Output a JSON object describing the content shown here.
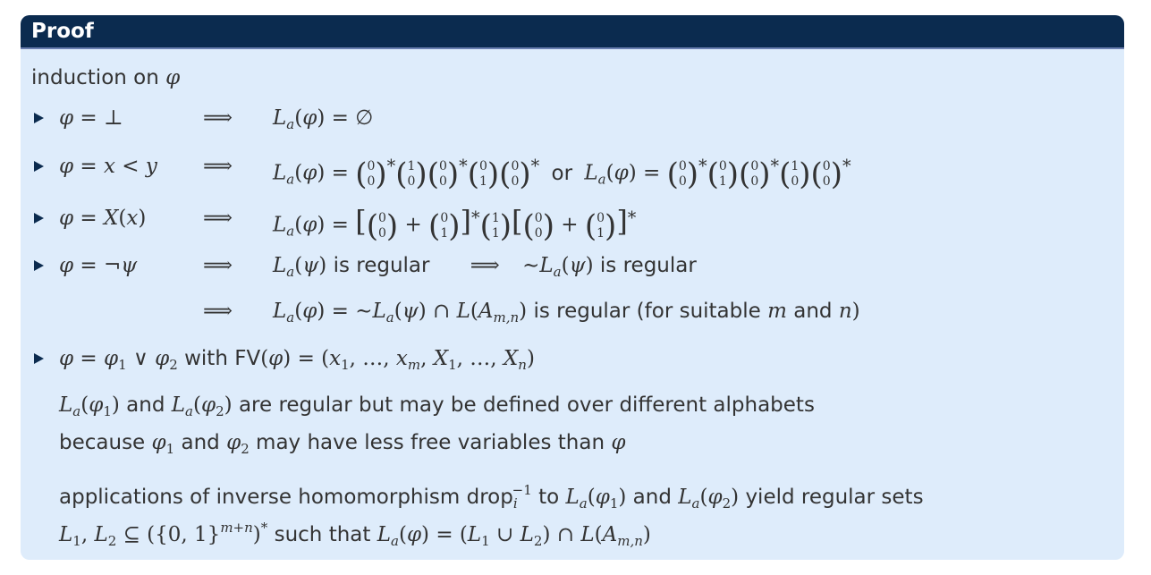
{
  "block": {
    "title": "Proof"
  },
  "lines": {
    "intro": "induction on",
    "intro_phi": "φ",
    "case1_lhs": "φ = ⊥",
    "implies": "⟹",
    "case1_rhs_L": "L",
    "sub_a": "a",
    "case1_rhs_rest": "(φ) = ∅",
    "case2_lhs": "φ = x < y",
    "case2_or": "or",
    "case3_lhs": "φ = X(x)",
    "case4_lhs": "φ = ¬ψ",
    "case4_mid": "(ψ)",
    "is_regular": "is regular",
    "tilde": "∼",
    "case4b_text": "is regular",
    "case4b_paren": "(for suitable",
    "m": "m",
    "and": "and",
    "n": "n",
    "close_paren": ")",
    "case5_lhs": "φ = φ",
    "case5_with": "with",
    "case5_fv": "FV(φ) = (x",
    "l6_a": "are regular but may be defined over different alphabets",
    "l7_a": "because",
    "l7_b": "may have less free variables than",
    "l8_a": "applications of inverse homomorphism",
    "l8_drop": "drop",
    "l8_to": "to",
    "l8_yield": "yield regular sets",
    "l9_such": "such that"
  }
}
